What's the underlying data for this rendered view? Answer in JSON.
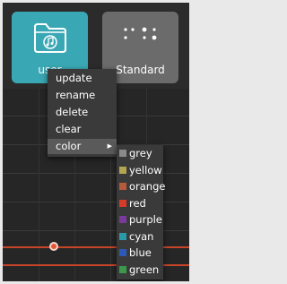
{
  "tiles": {
    "user": {
      "label": "user",
      "icon": "folder-music-icon",
      "color": "#3aa8b4"
    },
    "standard": {
      "label": "Standard",
      "icon": "dots-grid-icon",
      "color": "#6b6b6b"
    }
  },
  "context_menu": {
    "items": [
      {
        "label": "update"
      },
      {
        "label": "rename"
      },
      {
        "label": "delete"
      },
      {
        "label": "clear"
      },
      {
        "label": "color",
        "has_submenu": true
      }
    ]
  },
  "color_submenu": {
    "items": [
      {
        "label": "grey",
        "swatch": "#8a8a8a"
      },
      {
        "label": "yellow",
        "swatch": "#b5a552"
      },
      {
        "label": "orange",
        "swatch": "#b55a3a"
      },
      {
        "label": "red",
        "swatch": "#d83a2a"
      },
      {
        "label": "purple",
        "swatch": "#7a3a9a"
      },
      {
        "label": "cyan",
        "swatch": "#2a9aa8"
      },
      {
        "label": "blue",
        "swatch": "#2a5ab5"
      },
      {
        "label": "green",
        "swatch": "#3a9a4a"
      }
    ]
  },
  "colors": {
    "accent_line": "#c8452a",
    "playhead_dot": "#e8533a"
  }
}
